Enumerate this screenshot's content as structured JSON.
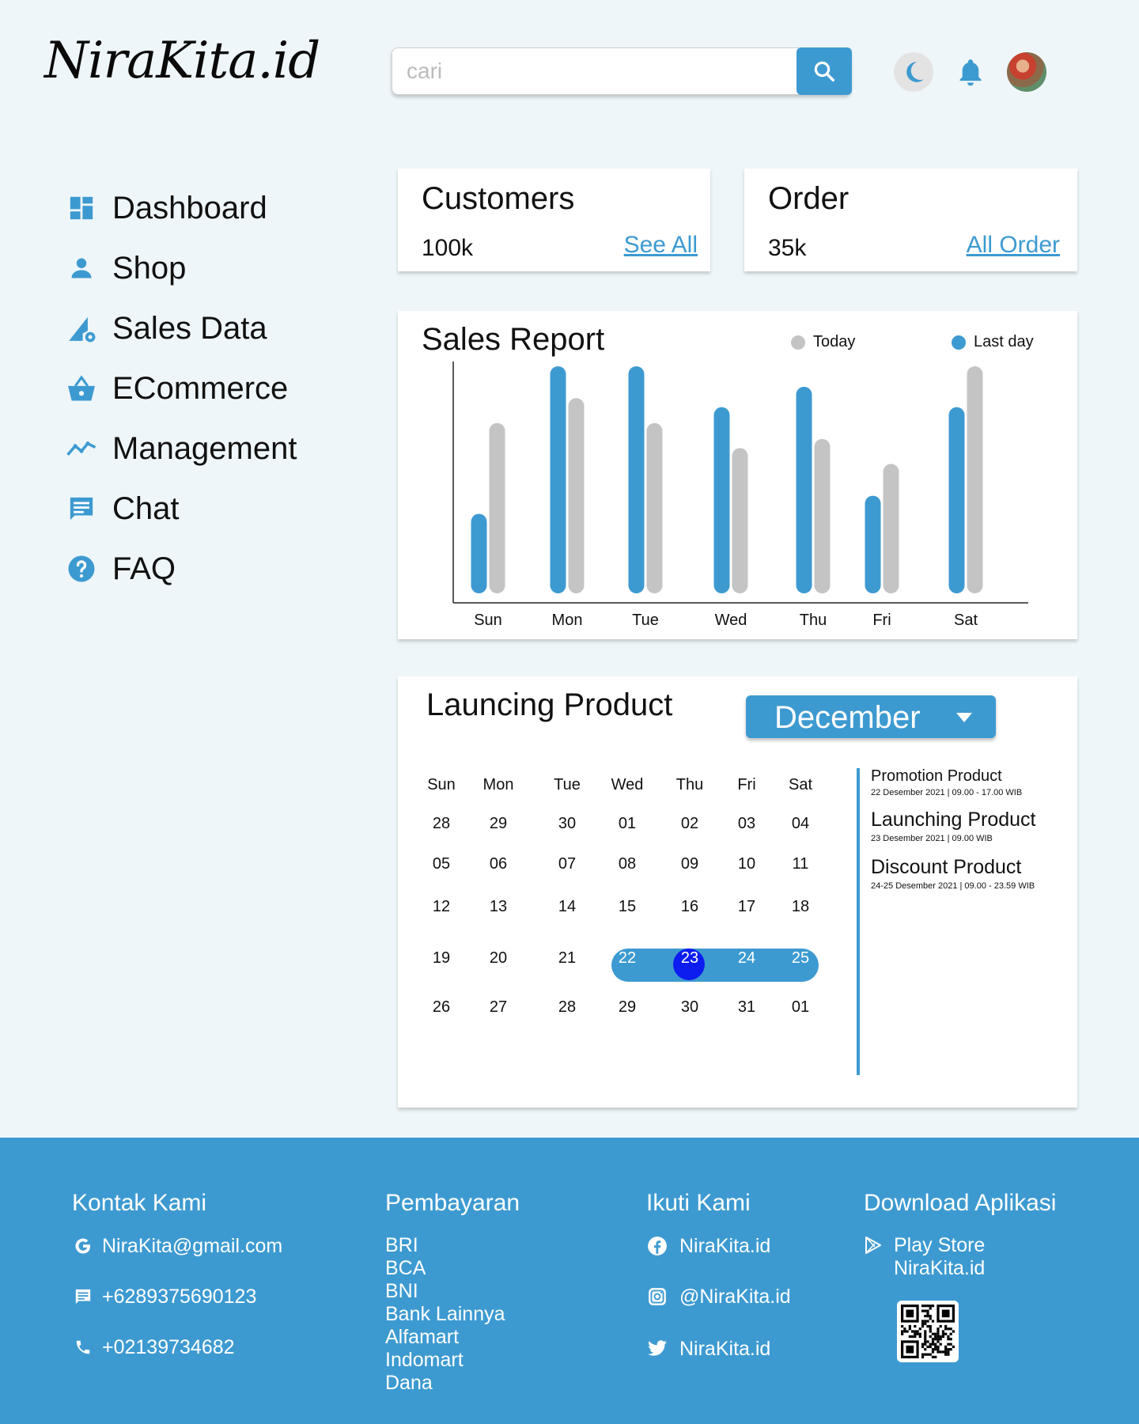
{
  "header": {
    "logo_text": "NiraKita.id",
    "search_placeholder": "cari"
  },
  "sidebar": {
    "items": [
      {
        "label": "Dashboard",
        "icon": "dashboard-icon"
      },
      {
        "label": "Shop",
        "icon": "person-icon"
      },
      {
        "label": "Sales Data",
        "icon": "sales-chart-gear-icon"
      },
      {
        "label": "ECommerce",
        "icon": "basket-icon"
      },
      {
        "label": "Management",
        "icon": "trend-line-icon"
      },
      {
        "label": "Chat",
        "icon": "chat-icon"
      },
      {
        "label": "FAQ",
        "icon": "help-icon"
      }
    ]
  },
  "stats": {
    "customers": {
      "title": "Customers",
      "value": "100k",
      "link": "See All"
    },
    "order": {
      "title": "Order",
      "value": "35k",
      "link": "All Order"
    }
  },
  "sales_report": {
    "title": "Sales Report",
    "legend_today": "Today",
    "legend_lastday": "Last day"
  },
  "chart_data": {
    "type": "bar",
    "categories": [
      "Sun",
      "Mon",
      "Tue",
      "Wed",
      "Thu",
      "Fri",
      "Sat"
    ],
    "series": [
      {
        "name": "Last day",
        "color": "#3d9ad1",
        "values": [
          35,
          100,
          100,
          82,
          91,
          43,
          82
        ]
      },
      {
        "name": "Today",
        "color": "#c4c4c4",
        "values": [
          75,
          86,
          75,
          64,
          68,
          57,
          100
        ]
      }
    ],
    "ylim": [
      0,
      100
    ],
    "grid": false
  },
  "launch": {
    "title": "Launcing Product",
    "month": "December",
    "weekdays": [
      "Sun",
      "Mon",
      "Tue",
      "Wed",
      "Thu",
      "Fri",
      "Sat"
    ],
    "weeks": [
      [
        "28",
        "29",
        "30",
        "01",
        "02",
        "03",
        "04"
      ],
      [
        "05",
        "06",
        "07",
        "08",
        "09",
        "10",
        "11"
      ],
      [
        "12",
        "13",
        "14",
        "15",
        "16",
        "17",
        "18"
      ],
      [
        "19",
        "20",
        "21",
        "22",
        "23",
        "24",
        "25"
      ],
      [
        "26",
        "27",
        "28",
        "29",
        "30",
        "31",
        "01"
      ]
    ],
    "selected_day": "23",
    "range_start": "22",
    "range_end": "25",
    "events": [
      {
        "title": "Promotion Product",
        "date": "22 Desember 2021 | 09.00 - 17.00 WIB"
      },
      {
        "title": "Launching Product",
        "date": "23 Desember 2021 | 09.00 WIB"
      },
      {
        "title": "Discount Product",
        "date": "24-25 Desember 2021 | 09.00 - 23.59 WIB"
      }
    ]
  },
  "footer": {
    "contact": {
      "heading": "Kontak Kami",
      "email": "NiraKita@gmail.com",
      "sms": "+6289375690123",
      "phone": "+02139734682"
    },
    "payment": {
      "heading": "Pembayaran",
      "items": [
        "BRI",
        "BCA",
        "BNI",
        "Bank Lainnya",
        "Alfamart",
        "Indomart",
        "Dana"
      ]
    },
    "follow": {
      "heading": "Ikuti Kami",
      "facebook": "NiraKita.id",
      "instagram": "@NiraKita.id",
      "twitter": "NiraKita.id"
    },
    "download": {
      "heading": "Download Aplikasi",
      "store": "Play Store",
      "app_name": "NiraKita.id"
    }
  },
  "colors": {
    "accent": "#3d9ad1",
    "bar_secondary": "#c4c4c4",
    "selected_day": "#0d1df0",
    "background": "#eef6f9"
  }
}
